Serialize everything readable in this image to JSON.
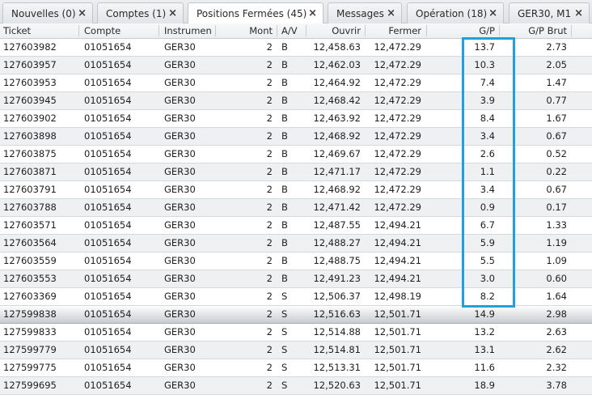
{
  "tabs": [
    {
      "label": "Nouvelles (0)",
      "close": "×"
    },
    {
      "label": "Comptes (1)",
      "close": "×"
    },
    {
      "label": "Positions Fermées (45)",
      "close": "×",
      "active": true
    },
    {
      "label": "Messages",
      "close": "×"
    },
    {
      "label": "Opération (18)",
      "close": "×"
    },
    {
      "label": "GER30, M1",
      "close": "×"
    }
  ],
  "columns": [
    "Ticket",
    "Compte",
    "Instrumen",
    "Mont",
    "A/V",
    "Ouvrir",
    "Fermer",
    "G/P",
    "G/P Brut"
  ],
  "rows": [
    [
      "127603982",
      "01051654",
      "GER30",
      "2",
      "B",
      "12,458.63",
      "12,472.29",
      "13.7",
      "2.73"
    ],
    [
      "127603957",
      "01051654",
      "GER30",
      "2",
      "B",
      "12,462.03",
      "12,472.29",
      "10.3",
      "2.05"
    ],
    [
      "127603953",
      "01051654",
      "GER30",
      "2",
      "B",
      "12,464.92",
      "12,472.29",
      "7.4",
      "1.47"
    ],
    [
      "127603945",
      "01051654",
      "GER30",
      "2",
      "B",
      "12,468.42",
      "12,472.29",
      "3.9",
      "0.77"
    ],
    [
      "127603902",
      "01051654",
      "GER30",
      "2",
      "B",
      "12,463.92",
      "12,472.29",
      "8.4",
      "1.67"
    ],
    [
      "127603898",
      "01051654",
      "GER30",
      "2",
      "B",
      "12,468.92",
      "12,472.29",
      "3.4",
      "0.67"
    ],
    [
      "127603875",
      "01051654",
      "GER30",
      "2",
      "B",
      "12,469.67",
      "12,472.29",
      "2.6",
      "0.52"
    ],
    [
      "127603871",
      "01051654",
      "GER30",
      "2",
      "B",
      "12,471.17",
      "12,472.29",
      "1.1",
      "0.22"
    ],
    [
      "127603791",
      "01051654",
      "GER30",
      "2",
      "B",
      "12,468.92",
      "12,472.29",
      "3.4",
      "0.67"
    ],
    [
      "127603788",
      "01051654",
      "GER30",
      "2",
      "B",
      "12,471.42",
      "12,472.29",
      "0.9",
      "0.17"
    ],
    [
      "127603571",
      "01051654",
      "GER30",
      "2",
      "B",
      "12,487.55",
      "12,494.21",
      "6.7",
      "1.33"
    ],
    [
      "127603564",
      "01051654",
      "GER30",
      "2",
      "B",
      "12,488.27",
      "12,494.21",
      "5.9",
      "1.19"
    ],
    [
      "127603559",
      "01051654",
      "GER30",
      "2",
      "B",
      "12,488.75",
      "12,494.21",
      "5.5",
      "1.09"
    ],
    [
      "127603553",
      "01051654",
      "GER30",
      "2",
      "B",
      "12,491.23",
      "12,494.21",
      "3.0",
      "0.60"
    ],
    [
      "127603369",
      "01051654",
      "GER30",
      "2",
      "S",
      "12,506.37",
      "12,498.19",
      "8.2",
      "1.64"
    ],
    [
      "127599838",
      "01051654",
      "GER30",
      "2",
      "S",
      "12,516.63",
      "12,501.71",
      "14.9",
      "2.98"
    ],
    [
      "127599833",
      "01051654",
      "GER30",
      "2",
      "S",
      "12,514.88",
      "12,501.71",
      "13.2",
      "2.63"
    ],
    [
      "127599779",
      "01051654",
      "GER30",
      "2",
      "S",
      "12,514.81",
      "12,501.71",
      "13.1",
      "2.62"
    ],
    [
      "127599775",
      "01051654",
      "GER30",
      "2",
      "S",
      "12,513.31",
      "12,501.71",
      "11.6",
      "2.32"
    ],
    [
      "127599695",
      "01051654",
      "GER30",
      "2",
      "S",
      "12,520.63",
      "12,501.71",
      "18.9",
      "3.78"
    ]
  ],
  "selected_row": 15,
  "colors": {
    "highlight": "#1aa3e0",
    "selected": "#c9ccd0",
    "stripe": "#eef0f2"
  }
}
